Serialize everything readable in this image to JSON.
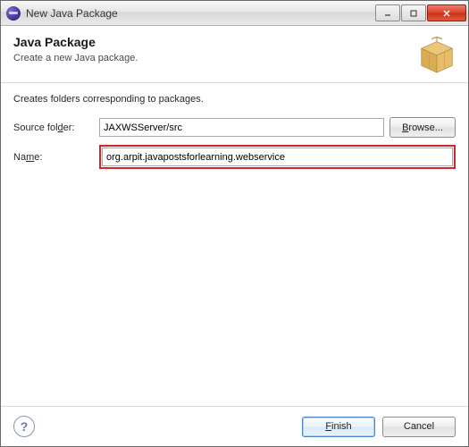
{
  "window": {
    "title": "New Java Package"
  },
  "header": {
    "title": "Java Package",
    "subtitle": "Create a new Java package."
  },
  "body": {
    "instruction": "Creates folders corresponding to packages.",
    "sourceFolder": {
      "label": "Source folder:",
      "value": "JAXWSServer/src",
      "browse": "Browse..."
    },
    "name": {
      "label": "Name:",
      "value": "org.arpit.javapostsforlearning.webservice"
    }
  },
  "footer": {
    "finish": "Finish",
    "cancel": "Cancel"
  }
}
